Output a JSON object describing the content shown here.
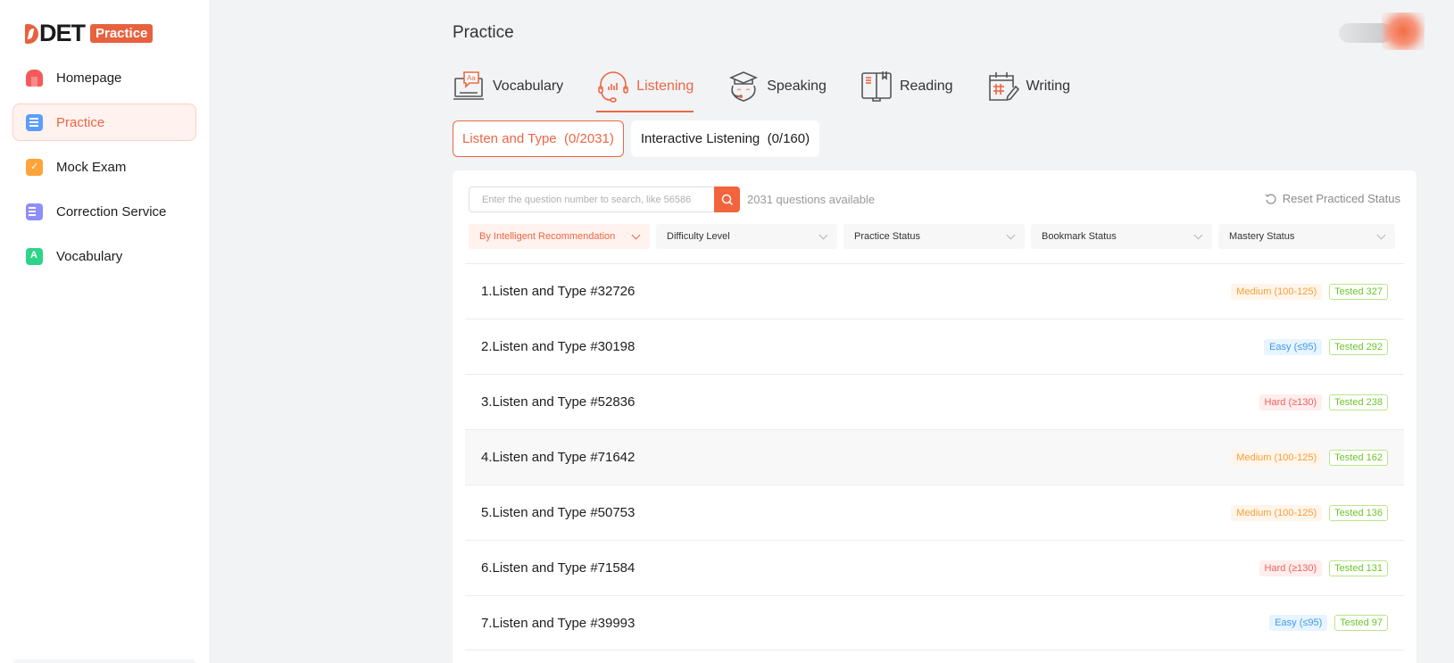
{
  "app": {
    "logo_text": "DET",
    "logo_badge": "Practice"
  },
  "sidebar": {
    "items": [
      {
        "label": "Homepage",
        "icon": "home-icon",
        "active": false
      },
      {
        "label": "Practice",
        "icon": "practice-icon",
        "active": true
      },
      {
        "label": "Mock Exam",
        "icon": "mock-exam-icon",
        "active": false
      },
      {
        "label": "Correction Service",
        "icon": "correction-icon",
        "active": false
      },
      {
        "label": "Vocabulary",
        "icon": "vocabulary-icon",
        "active": false
      }
    ]
  },
  "header": {
    "title": "Practice"
  },
  "tabs": [
    {
      "label": "Vocabulary",
      "icon": "vocabulary-laptop-icon",
      "active": false
    },
    {
      "label": "Listening",
      "icon": "headphones-icon",
      "active": true
    },
    {
      "label": "Speaking",
      "icon": "graduate-headset-icon",
      "active": false
    },
    {
      "label": "Reading",
      "icon": "book-icon",
      "active": false
    },
    {
      "label": "Writing",
      "icon": "calendar-pencil-icon",
      "active": false
    }
  ],
  "subtabs": [
    {
      "label": "Listen and Type  (0/2031)",
      "active": true
    },
    {
      "label": "Interactive Listening  (0/160)",
      "active": false
    }
  ],
  "search": {
    "placeholder": "Enter the question number to search, like 56586",
    "value": "",
    "available_text": "2031 questions available"
  },
  "reset_label": "Reset Practiced Status",
  "filters": [
    {
      "label": "By Intelligent Recommendation",
      "active": true
    },
    {
      "label": "Difficulty Level",
      "active": false
    },
    {
      "label": "Practice Status",
      "active": false
    },
    {
      "label": "Bookmark Status",
      "active": false
    },
    {
      "label": "Mastery Status",
      "active": false
    }
  ],
  "questions": [
    {
      "title": "1.Listen and Type #32726",
      "difficulty": "Medium (100-125)",
      "level": "medium",
      "tested": "Tested 327"
    },
    {
      "title": "2.Listen and Type #30198",
      "difficulty": "Easy (≤95)",
      "level": "easy",
      "tested": "Tested 292"
    },
    {
      "title": "3.Listen and Type #52836",
      "difficulty": "Hard (≥130)",
      "level": "hard",
      "tested": "Tested 238"
    },
    {
      "title": "4.Listen and Type #71642",
      "difficulty": "Medium (100-125)",
      "level": "medium",
      "tested": "Tested 162"
    },
    {
      "title": "5.Listen and Type #50753",
      "difficulty": "Medium (100-125)",
      "level": "medium",
      "tested": "Tested 136"
    },
    {
      "title": "6.Listen and Type #71584",
      "difficulty": "Hard (≥130)",
      "level": "hard",
      "tested": "Tested 131"
    },
    {
      "title": "7.Listen and Type #39993",
      "difficulty": "Easy (≤95)",
      "level": "easy",
      "tested": "Tested 97"
    }
  ],
  "colors": {
    "accent": "#ec6744",
    "medium": "#f5a03c",
    "easy": "#3d9af0",
    "hard": "#f0605a",
    "tested": "#6cc52a"
  }
}
